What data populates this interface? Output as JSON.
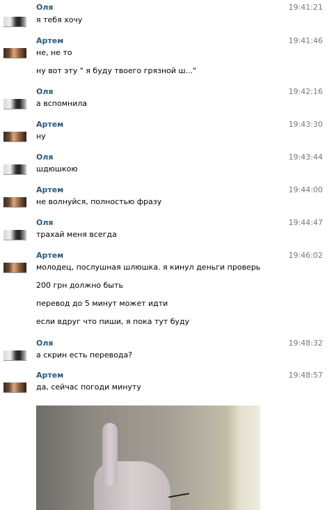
{
  "messages": [
    {
      "author": "Оля",
      "time": "19:41:21",
      "lines": [
        "я тебя хочу"
      ]
    },
    {
      "author": "Артем",
      "time": "19:41:46",
      "lines": [
        "не, не то",
        "ну вот эту \" я буду твоего грязной ш...\""
      ]
    },
    {
      "author": "Оля",
      "time": "19:42:16",
      "lines": [
        "а вспомнила"
      ]
    },
    {
      "author": "Артем",
      "time": "19:43:30",
      "lines": [
        "ну"
      ]
    },
    {
      "author": "Оля",
      "time": "19:43:44",
      "lines": [
        "шдюшкою"
      ]
    },
    {
      "author": "Артем",
      "time": "19:44:00",
      "lines": [
        "не волнуйся, полностью фразу"
      ]
    },
    {
      "author": "Оля",
      "time": "19:44:47",
      "lines": [
        "трахай меня всегда"
      ]
    },
    {
      "author": "Артем",
      "time": "19:46:02",
      "lines": [
        "молодец, послушная шлюшка. я кинул деньги проверь",
        "200 грн должно быть",
        "перевод до 5 минут может идти",
        "если вдруг что пиши, я пока тут буду"
      ]
    },
    {
      "author": "Оля",
      "time": "19:48:32",
      "lines": [
        "а скрин есть перевода?"
      ]
    },
    {
      "author": "Артем",
      "time": "19:48:57",
      "lines": [
        "да, сейчас погоди минуту"
      ]
    }
  ]
}
